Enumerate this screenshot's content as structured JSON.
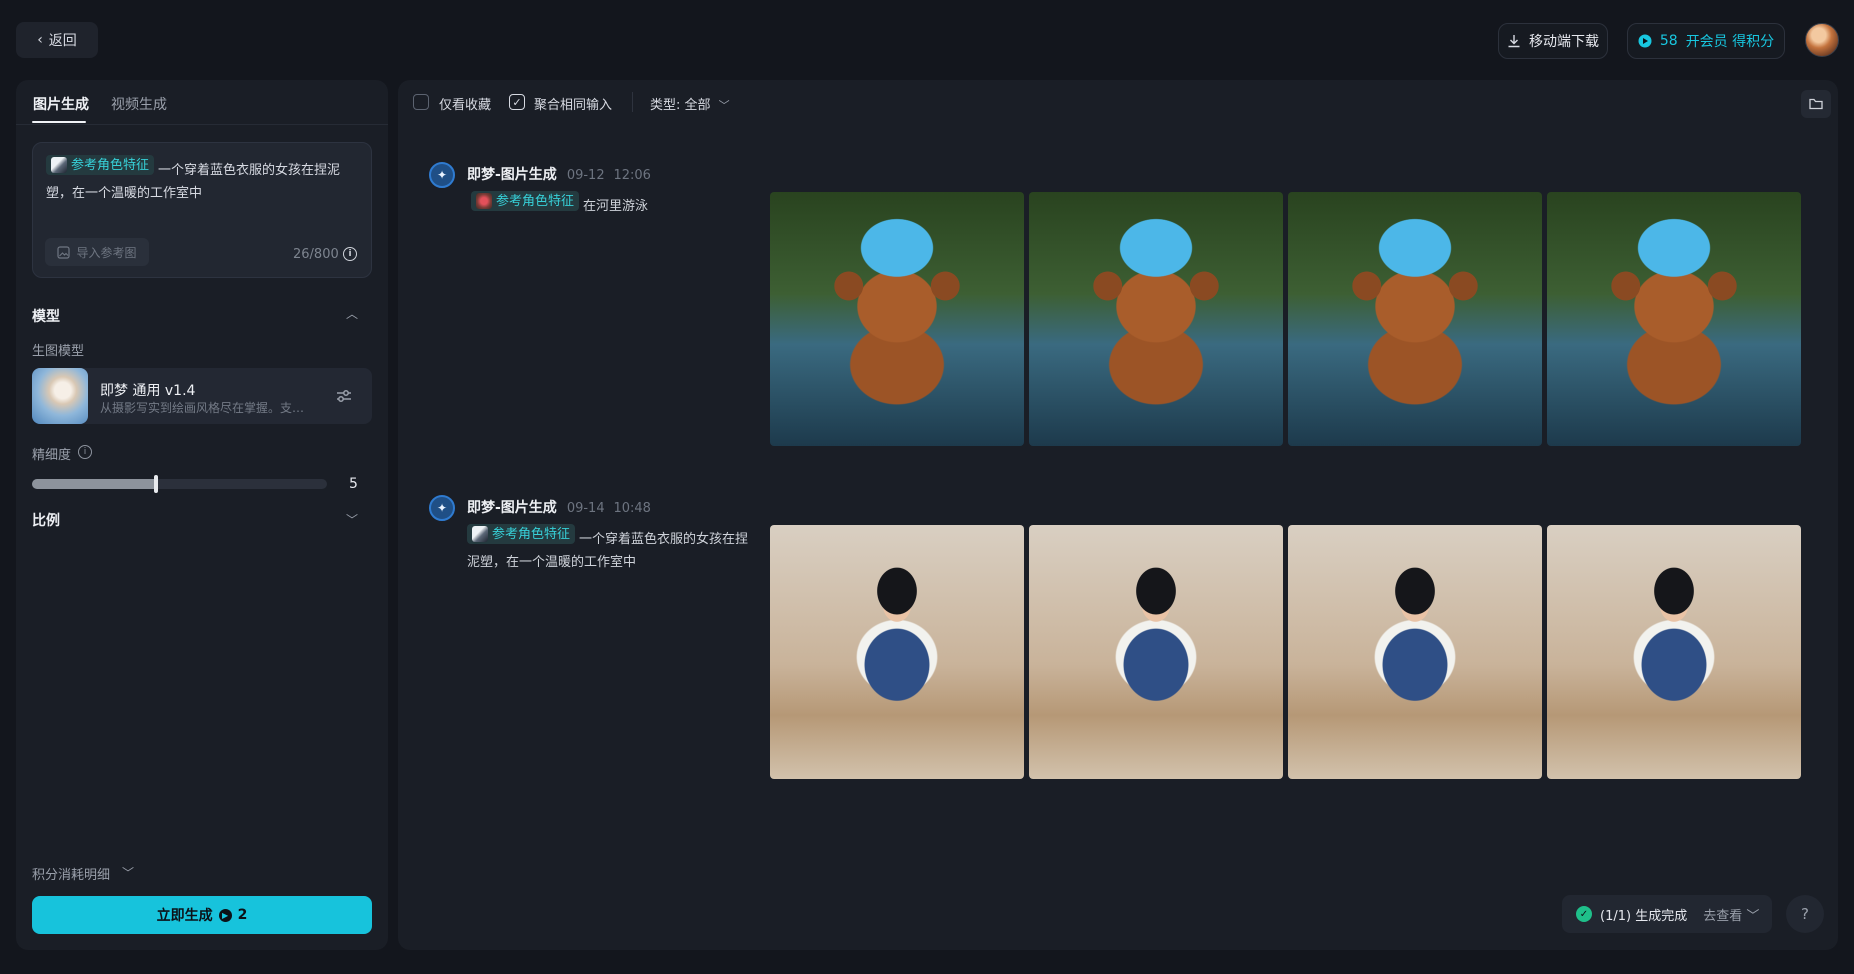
{
  "header": {
    "back_label": "返回",
    "download_label": "移动端下载",
    "points": "58",
    "points_cta": "开会员 得积分"
  },
  "left": {
    "tabs": [
      {
        "label": "图片生成",
        "active": true
      },
      {
        "label": "视频生成",
        "active": false
      }
    ],
    "prompt": {
      "chip_label": "参考角色特征",
      "text": "一个穿着蓝色衣服的女孩在捏泥塑，在一个温暖的工作室中",
      "import_label": "导入参考图",
      "char_count": "26/800"
    },
    "model_section": {
      "title": "模型",
      "sub_label": "生图模型",
      "model_name": "即梦 通用 v1.4",
      "model_desc": "从摄影写实到绘画风格尽在掌握。支…"
    },
    "fineness": {
      "label": "精细度",
      "value": "5",
      "fill_fraction": 0.42
    },
    "ratio_title": "比例",
    "cost_detail": "积分消耗明细",
    "generate": {
      "label": "立即生成",
      "cost": "2"
    }
  },
  "toolbar": {
    "fav_only": "仅看收藏",
    "merge_label": "聚合相同输入",
    "type_filter": "类型: 全部"
  },
  "generations": [
    {
      "title": "即梦-图片生成",
      "date": "09-12",
      "time": "12:06",
      "chip_label": "参考角色特征",
      "prompt": "在河里游泳",
      "image_kind": "bear"
    },
    {
      "title": "即梦-图片生成",
      "date": "09-14",
      "time": "10:48",
      "chip_label": "参考角色特征",
      "prompt": "一个穿着蓝色衣服的女孩在捏泥塑，在一个温暖的工作室中",
      "image_kind": "girl"
    }
  ],
  "status": {
    "text": "(1/1) 生成完成",
    "view_label": "去查看"
  },
  "help_label": "?",
  "colors": {
    "accent": "#17c3dc",
    "panel_bg": "#1a1e26",
    "page_bg": "#13161d",
    "success": "#1fbf8a"
  }
}
